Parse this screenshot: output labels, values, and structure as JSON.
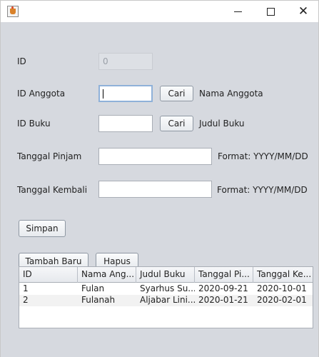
{
  "window": {
    "title": "",
    "controls": {
      "minimize": "minimize-icon",
      "maximize": "maximize-icon",
      "close": "close-icon"
    }
  },
  "form": {
    "id_label": "ID",
    "id_value": "0",
    "id_anggota_label": "ID Anggota",
    "id_anggota_value": "",
    "cari_anggota_button": "Cari",
    "nama_anggota_label": "Nama Anggota",
    "id_buku_label": "ID Buku",
    "id_buku_value": "",
    "cari_buku_button": "Cari",
    "judul_buku_label": "Judul Buku",
    "tanggal_pinjam_label": "Tanggal Pinjam",
    "tanggal_pinjam_value": "",
    "tanggal_pinjam_format": "Format: YYYY/MM/DD",
    "tanggal_kembali_label": "Tanggal Kembali",
    "tanggal_kembali_value": "",
    "tanggal_kembali_format": "Format: YYYY/MM/DD"
  },
  "actions": {
    "simpan": "Simpan",
    "tambah_baru": "Tambah Baru",
    "hapus": "Hapus"
  },
  "table": {
    "columns": [
      "ID",
      "Nama Ang...",
      "Judul Buku",
      "Tanggal Pi...",
      "Tanggal Ke..."
    ],
    "rows": [
      [
        "1",
        "Fulan",
        "Syarhus Su...",
        "2020-09-21",
        "2020-10-01"
      ],
      [
        "2",
        "Fulanah",
        "Aljabar Lini...",
        "2020-01-21",
        "2020-02-01"
      ]
    ]
  },
  "colors": {
    "panel_background": "#d6d9df",
    "field_border": "#a9aeb6",
    "focus_border": "#8fb1d9"
  }
}
